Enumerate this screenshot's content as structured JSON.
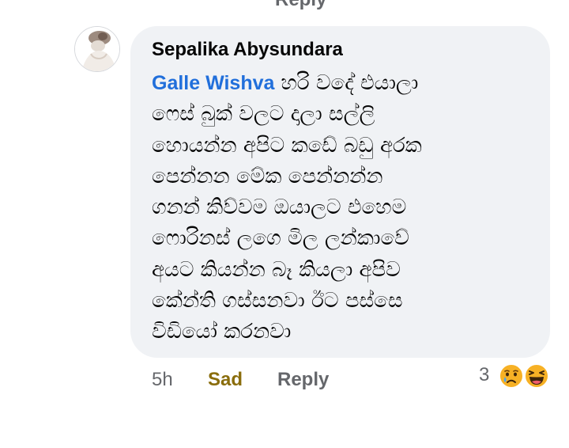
{
  "comment": {
    "author": "Sepalika Abysundara",
    "mention": "Galle Wishva",
    "body_lines": [
      "හරි වදේ එයාලා",
      "ෆෙස් බුක් වලට  දාලා සල්ලි",
      "හොයන්න  අපිට කඩේ බඩු අරක",
      "පෙන්නන මේක  පෙන්නන්න",
      "ගනන් කිව්වම  ඔයාලට  එහෙම",
      "ෆොරිනස් ලගෙ මිල  ලන්කාවේ",
      "අයට කියන්න බෑ කියලා  අපිව",
      "කේන්ති ගස්සනවා  ඊට පස්සෙ",
      "විඩියෝ කරනවා"
    ]
  },
  "actions": {
    "time": "5h",
    "reaction_label": "Sad",
    "reply_label": "Reply",
    "top_sliver_label": "Reply"
  },
  "reactions": {
    "count": "3",
    "icons": [
      "sad-face-icon",
      "laughing-face-icon"
    ]
  },
  "colors": {
    "bubble_bg": "#f0f2f5",
    "mention": "#216fdb",
    "sad_label": "#8a6d0c",
    "secondary_text": "#65676b",
    "reaction_face": "#f7b125"
  }
}
